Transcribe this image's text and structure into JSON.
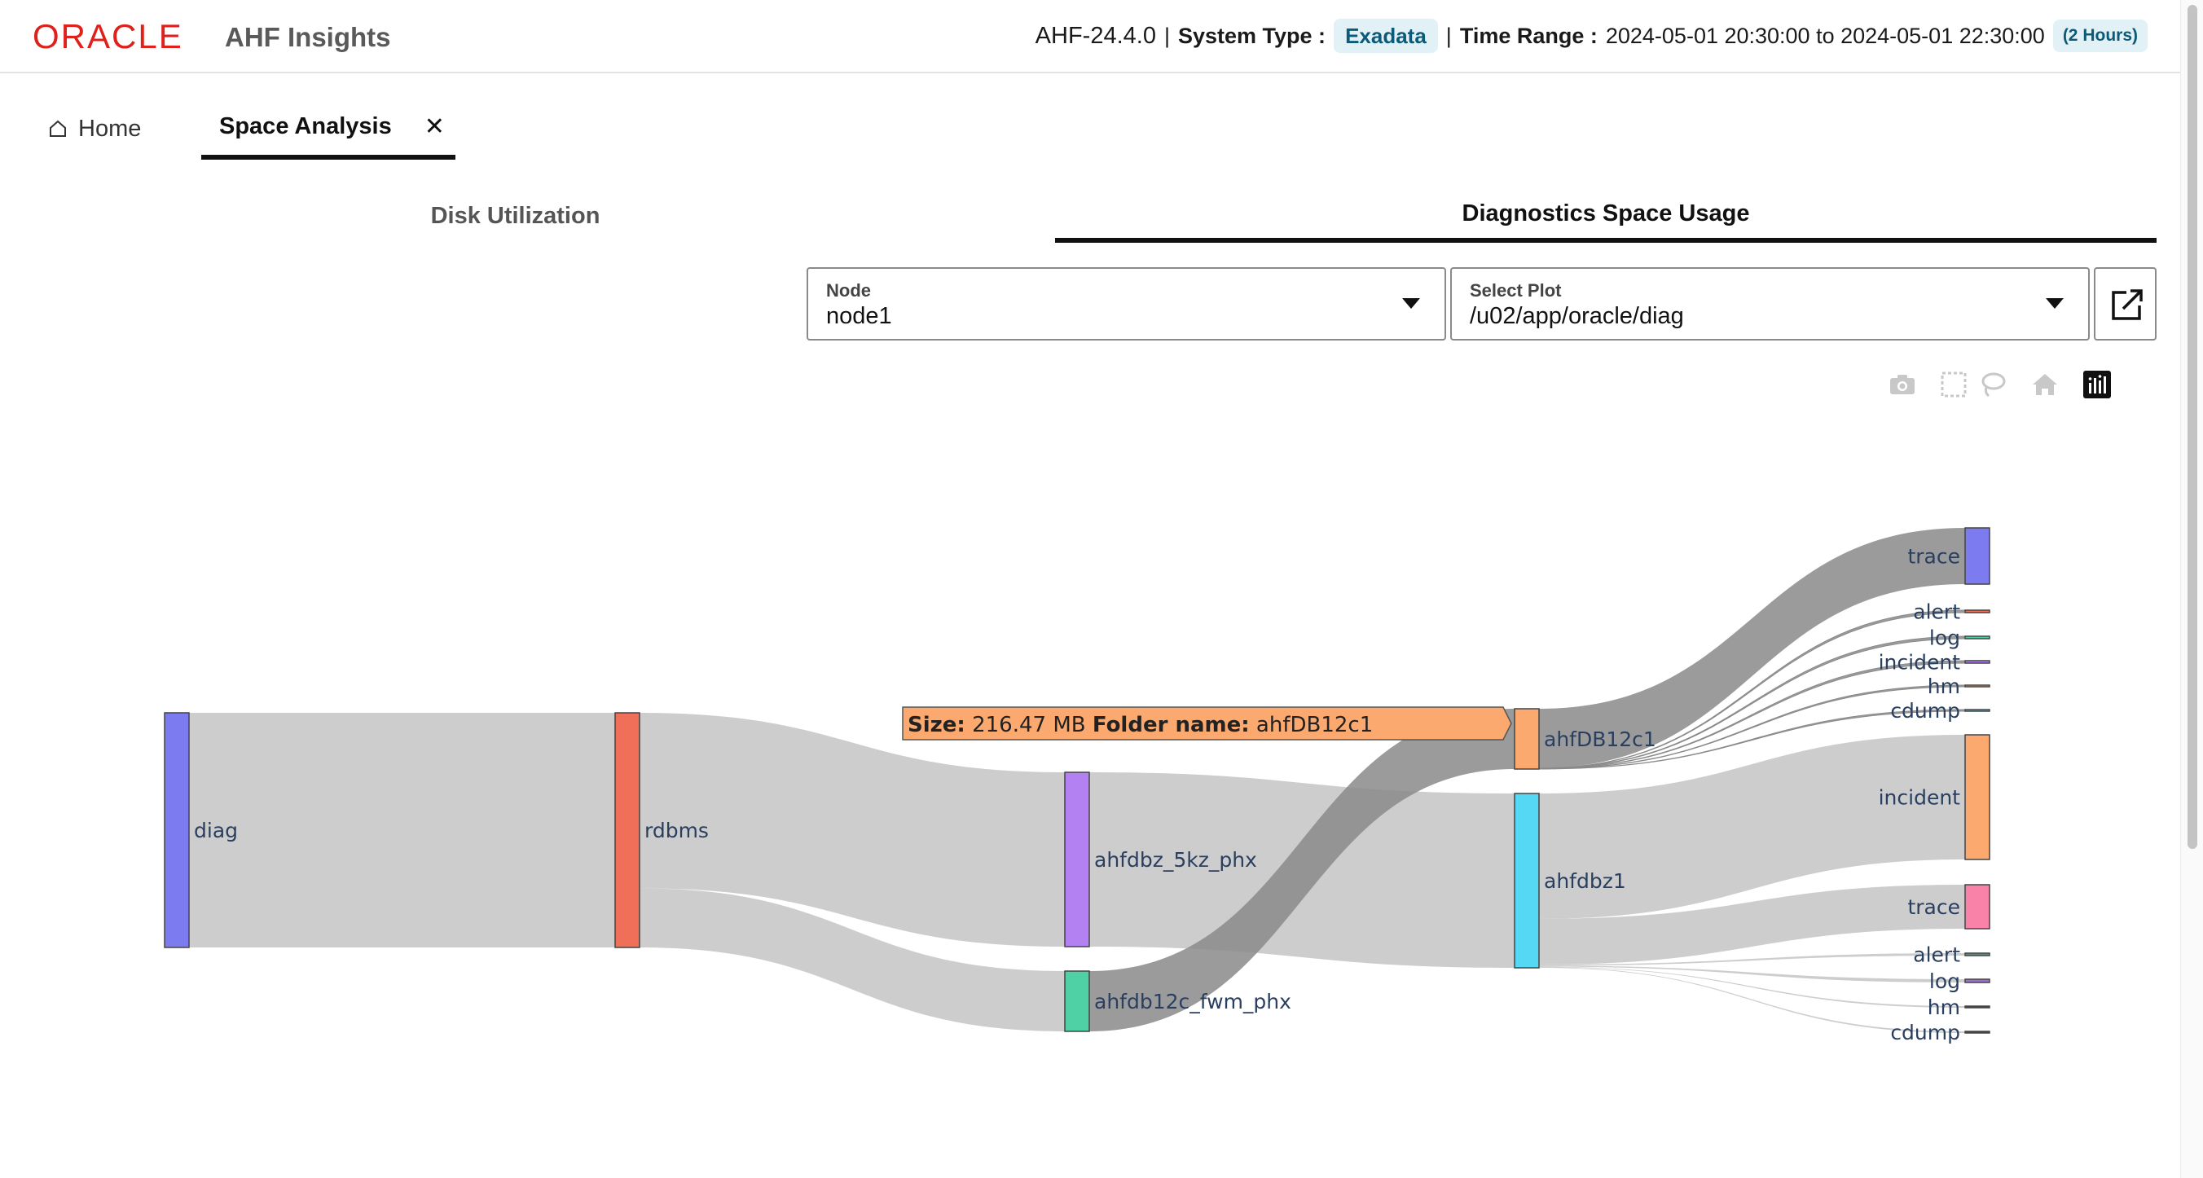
{
  "header": {
    "logo": "ORACLE",
    "app_title": "AHF Insights",
    "version": "AHF-24.4.0",
    "separator": "|",
    "system_type_label": "System Type :",
    "system_type_value": "Exadata",
    "time_range_label": "Time Range :",
    "time_range_value": "2024-05-01 20:30:00 to 2024-05-01 22:30:00",
    "time_range_duration": "(2 Hours)"
  },
  "tabs": {
    "home_label": "Home",
    "active_label": "Space Analysis",
    "close_glyph": "✕"
  },
  "subtabs": {
    "disk": "Disk Utilization",
    "diag": "Diagnostics Space Usage"
  },
  "selects": {
    "node_label": "Node",
    "node_value": "node1",
    "plot_label": "Select Plot",
    "plot_value": "/u02/app/oracle/diag"
  },
  "modebar": {
    "icons": [
      "camera-icon",
      "box-select-icon",
      "lasso-select-icon",
      "home-reset-icon",
      "plotly-logo-icon"
    ]
  },
  "chart_data": {
    "type": "sankey",
    "colors": {
      "link": "#c8c8c8",
      "link_highlight": "#8a8a8a",
      "label": "#2a3f5f"
    },
    "nodes": [
      {
        "label": "diag",
        "color": "#7c7cf0"
      },
      {
        "label": "rdbms",
        "color": "#ef6f59"
      },
      {
        "label": "ahfdbz_5kz_phx",
        "color": "#b381f2"
      },
      {
        "label": "ahfdb12c_fwm_phx",
        "color": "#4fd1a5"
      },
      {
        "label": "ahfDB12c1",
        "color": "#fca96f"
      },
      {
        "label": "ahfdbz1",
        "color": "#55d8f3"
      },
      {
        "label": "trace",
        "color": "#7c7cf0"
      },
      {
        "label": "alert",
        "color": "#ef6f59"
      },
      {
        "label": "log",
        "color": "#4fd1a5"
      },
      {
        "label": "incident",
        "color": "#b381f2"
      },
      {
        "label": "hm",
        "color": "#fca96f"
      },
      {
        "label": "cdump",
        "color": "#55d8f3"
      },
      {
        "label": "incident",
        "color": "#fca96f"
      },
      {
        "label": "trace",
        "color": "#f882a8"
      },
      {
        "label": "alert",
        "color": "#4a9a8a"
      },
      {
        "label": "log",
        "color": "#a070d0"
      },
      {
        "label": "hm",
        "color": "#444444"
      },
      {
        "label": "cdump",
        "color": "#444444"
      }
    ],
    "links": [
      {
        "source": 0,
        "target": 1,
        "value": 1070
      },
      {
        "source": 1,
        "target": 2,
        "value": 800
      },
      {
        "source": 1,
        "target": 3,
        "value": 270
      },
      {
        "source": 2,
        "target": 5,
        "value": 800
      },
      {
        "source": 3,
        "target": 4,
        "value": 270
      },
      {
        "source": 4,
        "target": 6,
        "value": 266
      },
      {
        "source": 4,
        "target": 7,
        "value": 1
      },
      {
        "source": 4,
        "target": 8,
        "value": 1
      },
      {
        "source": 4,
        "target": 9,
        "value": 1
      },
      {
        "source": 4,
        "target": 10,
        "value": 0.5
      },
      {
        "source": 4,
        "target": 11,
        "value": 0.5
      },
      {
        "source": 5,
        "target": 12,
        "value": 575
      },
      {
        "source": 5,
        "target": 13,
        "value": 210
      },
      {
        "source": 5,
        "target": 14,
        "value": 5
      },
      {
        "source": 5,
        "target": 15,
        "value": 5
      },
      {
        "source": 5,
        "target": 16,
        "value": 2.5
      },
      {
        "source": 5,
        "target": 17,
        "value": 2.5
      }
    ],
    "tooltip": {
      "size_label": "Size:",
      "size_value": "216.47 MB",
      "folder_label": "Folder name:",
      "folder_value": "ahfDB12c1"
    }
  }
}
